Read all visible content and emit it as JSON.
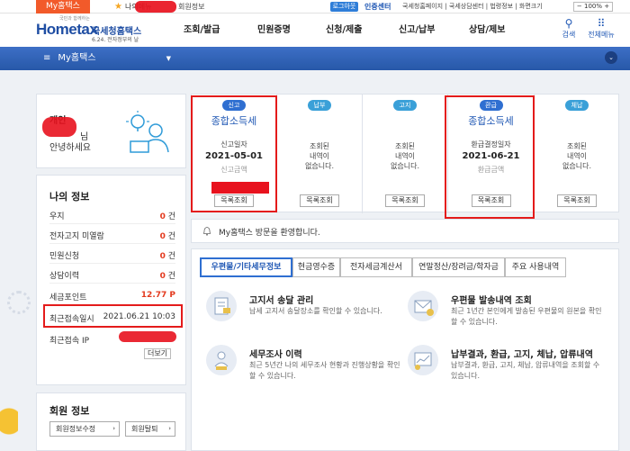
{
  "topbar": {
    "my_tab": "My홈택스",
    "my_menu": "나의메뉴",
    "member_info": "회원정보",
    "logout": "로그아웃",
    "cert_center": "인증센터",
    "util_links": "국세청홈페이지 | 국세상담센터 | 법령정보 | 화면크기",
    "zoom": "100%"
  },
  "header": {
    "logo_top": "국민과 함께하는",
    "logo_main": "Hometax",
    "logo_kr": "국세청홈택스",
    "logo_sub": "6.24. 전자정부의 날",
    "menu": [
      "조회/발급",
      "민원증명",
      "신청/제출",
      "신고/납부",
      "상담/제보"
    ],
    "search_label": "검색",
    "allmenu_label": "전체메뉴"
  },
  "nav": {
    "title": "My홈택스"
  },
  "welcome": {
    "label": "개인",
    "name_suffix": "님",
    "message": "안녕하세요"
  },
  "my_info": {
    "title": "나의 정보",
    "rows": [
      {
        "label": "우지",
        "value": "0",
        "unit": " 건"
      },
      {
        "label": "전자고지 미열람",
        "value": "0",
        "unit": " 건"
      },
      {
        "label": "민원신청",
        "value": "0",
        "unit": " 건"
      },
      {
        "label": "상담이력",
        "value": "0",
        "unit": " 건"
      },
      {
        "label": "세금포인트",
        "value": "12.77",
        "unit": " P"
      }
    ],
    "last_access_label": "최근접속일시",
    "last_access_value": "2021.06.21 10:03",
    "last_ip_label": "최근접속 IP",
    "more": "더보기"
  },
  "member": {
    "title": "회원 정보",
    "edit_btn": "회원정보수정",
    "withdraw_btn": "회원탈퇴"
  },
  "status": [
    {
      "badge": "신고",
      "badge_color": "#2f6fd1",
      "title": "종합소득세",
      "lines": [
        "신고일자"
      ],
      "date": "2021-05-01",
      "sub": "신고금액",
      "btn": "목록조회"
    },
    {
      "badge": "납부",
      "badge_color": "#3aa0d8",
      "title": "",
      "lines": [
        "조회된",
        "내역이",
        "없습니다."
      ],
      "date": "",
      "sub": "",
      "btn": "목록조회"
    },
    {
      "badge": "고지",
      "badge_color": "#3aa0d8",
      "title": "",
      "lines": [
        "조회된",
        "내역이",
        "없습니다."
      ],
      "date": "",
      "sub": "",
      "btn": "목록조회"
    },
    {
      "badge": "환급",
      "badge_color": "#2f6fd1",
      "title": "종합소득세",
      "lines": [
        "환급결정일자"
      ],
      "date": "2021-06-21",
      "sub": "환급금액",
      "btn": "목록조회"
    },
    {
      "badge": "체납",
      "badge_color": "#3aa0d8",
      "title": "",
      "lines": [
        "조회된",
        "내역이",
        "없습니다."
      ],
      "date": "",
      "sub": "",
      "btn": "목록조회"
    }
  ],
  "notice": {
    "text": "My홈택스 방문을 환영합니다."
  },
  "tabs": [
    "우편물/기타세무정보",
    "현금영수증",
    "전자세금계산서",
    "연말정산/장려금/학자금",
    "주요 사용내역"
  ],
  "services": [
    {
      "title": "고지서 송달 관리",
      "desc": "납세 고지서 송달장소를 확인할 수 있습니다."
    },
    {
      "title": "우편물 발송내역 조회",
      "desc": "최근 1년간 본인에게 발송된 우편물의 원본을 확인할 수 있습니다."
    },
    {
      "title": "세무조사 이력",
      "desc": "최근 5년간 나의 세무조사 현황과 진행상황을 확인할 수 있습니다."
    },
    {
      "title": "납부결과, 환급, 고지, 체납, 압류내역",
      "desc": "납부결과, 환급, 고지, 체납, 압류내역을 조회할 수 있습니다."
    }
  ]
}
